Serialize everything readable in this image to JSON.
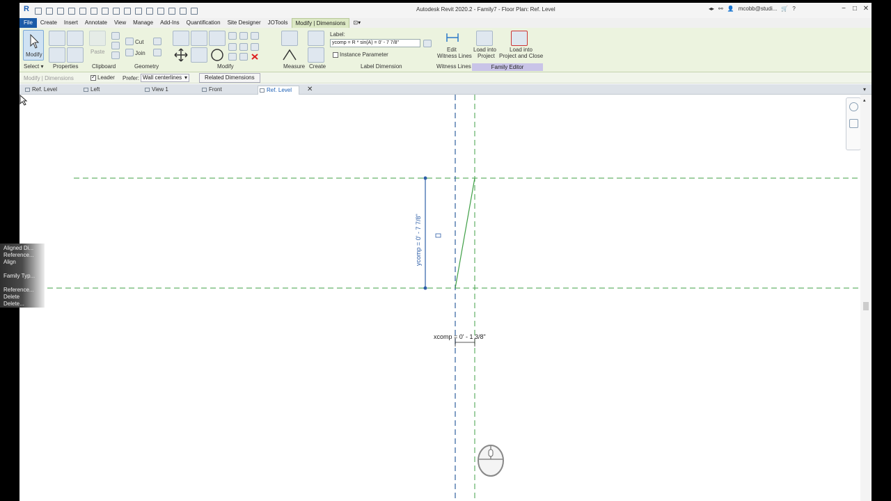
{
  "app": {
    "logo": "R",
    "window_title": "Autodesk Revit 2020.2 - Family7 - Floor Plan: Ref. Level",
    "user": "mcobb@studi...",
    "window_controls": [
      "−",
      "□",
      "✕"
    ]
  },
  "menu": {
    "items": [
      "File",
      "Create",
      "Insert",
      "Annotate",
      "View",
      "Manage",
      "Add-Ins",
      "Quantification",
      "Site Designer",
      "JOTools",
      "Modify | Dimensions"
    ]
  },
  "ribbon": {
    "modify_label": "Modify",
    "paste_label": "Paste",
    "cut_label": "Cut",
    "join_label": "Join",
    "label_caption": "Label:",
    "label_value": "ycomp = R * sin(A) = 0' - 7 7/8\"",
    "instance_parameter": "Instance Parameter",
    "edit_witness_lines": [
      "Edit",
      "Witness Lines"
    ],
    "load_into_project": [
      "Load into",
      "Project"
    ],
    "load_into_project_close": [
      "Load into",
      "Project and Close"
    ],
    "panels": {
      "select": "Select ▾",
      "properties": "Properties",
      "clipboard": "Clipboard",
      "geometry": "Geometry",
      "modify": "Modify",
      "measure": "Measure",
      "create": "Create",
      "label_dimension": "Label Dimension",
      "witness_lines": "Witness Lines",
      "family_editor": "Family Editor"
    }
  },
  "options_bar": {
    "context": "Modify | Dimensions",
    "leader_label": "Leader",
    "prefer_label": "Prefer:",
    "prefer_value": "Wall centerlines",
    "related_dimensions": "Related Dimensions"
  },
  "tabs": [
    {
      "label": "Ref. Level",
      "active": false
    },
    {
      "label": "Left",
      "active": false
    },
    {
      "label": "View 1",
      "active": false
    },
    {
      "label": "Front",
      "active": false
    },
    {
      "label": "Ref. Level",
      "active": true
    }
  ],
  "context_menu": {
    "items": [
      "Aligned Di...",
      "Reference...",
      "Align",
      "Family Typ...",
      "Reference...",
      "Delete",
      "Delete..."
    ]
  },
  "canvas": {
    "ydim_text": "ycomp = 0' - 7 7/8\"",
    "xdim_text": "xcomp = 0' - 1 3/8\""
  },
  "colors": {
    "file_tab": "#1b5ba8",
    "ribbon_bg": "#ecf3df",
    "ref_plane_green": "#3f9f46",
    "ref_plane_blue": "#2e5f9e",
    "dim_blue": "#2d5ea7"
  }
}
